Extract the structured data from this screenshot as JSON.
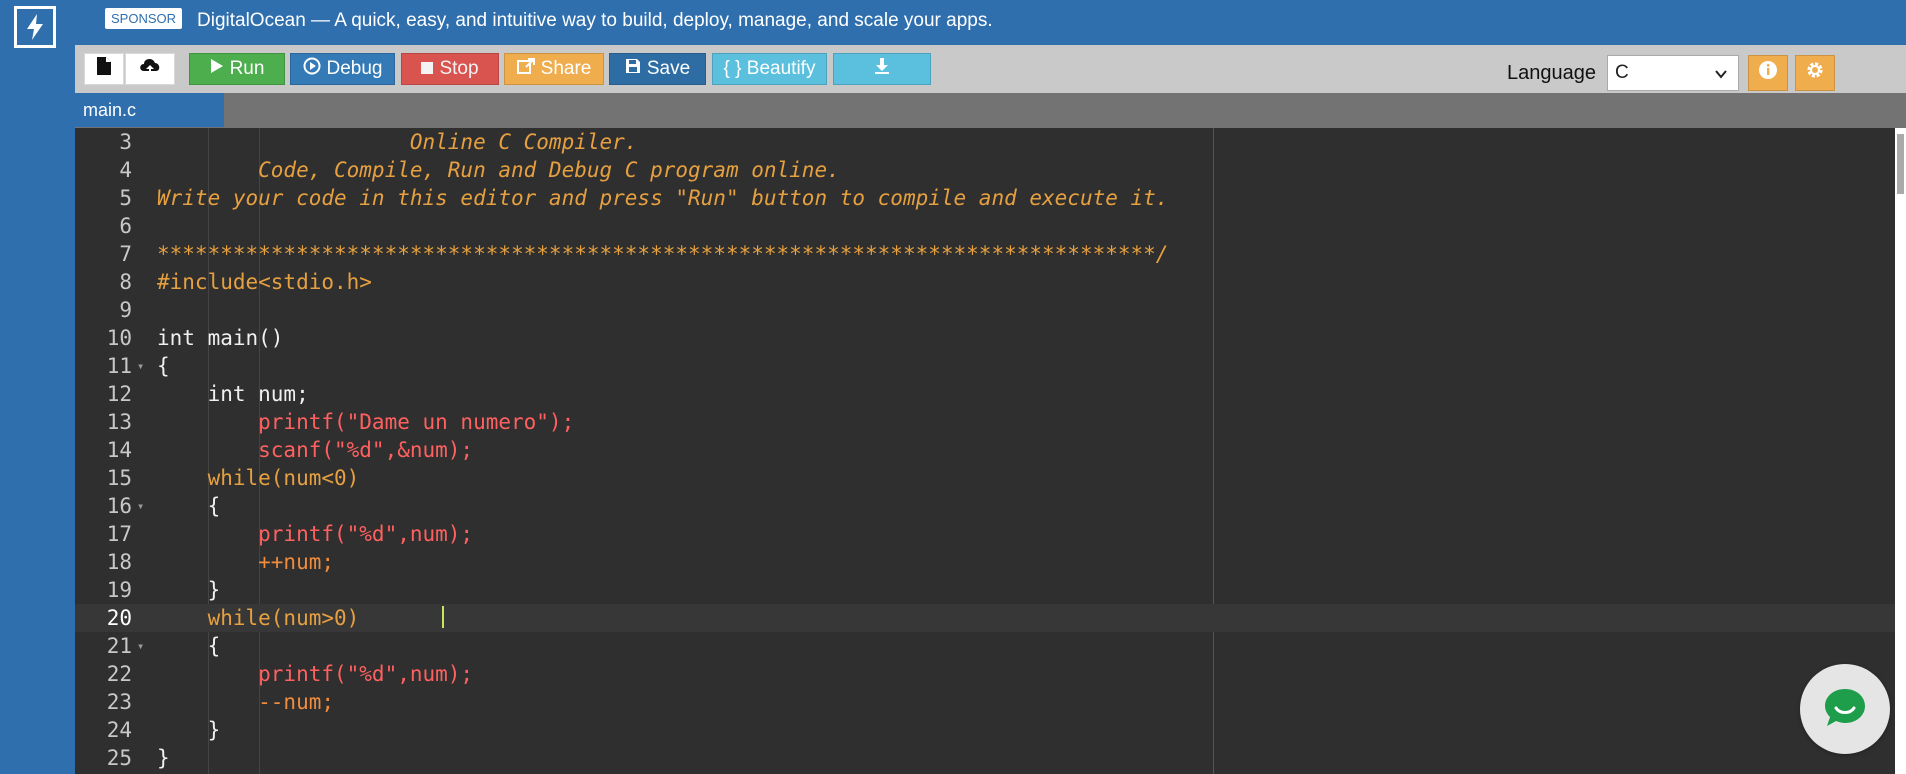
{
  "banner": {
    "sponsor_label": "SPONSOR",
    "text": "DigitalOcean — A quick, easy, and intuitive way to build, deploy, manage, and scale your apps."
  },
  "toolbar": {
    "run_label": "Run",
    "debug_label": "Debug",
    "stop_label": "Stop",
    "share_label": "Share",
    "save_label": "Save",
    "beautify_label": "{ } Beautify",
    "language_label": "Language",
    "language_value": "C"
  },
  "colors": {
    "run": "#4cae4c",
    "debug": "#337ab7",
    "stop": "#d9534f",
    "share": "#f0ad4e",
    "save": "#2e6da4",
    "beautify": "#5bc0de",
    "download": "#5bc0de",
    "info": "#f0ad4e",
    "settings": "#f0ad4e"
  },
  "tabs": [
    {
      "label": "main.c"
    }
  ],
  "editor": {
    "lines": [
      {
        "n": "3",
        "text": "                    Online C Compiler."
      },
      {
        "n": "4",
        "text": "        Code, Compile, Run and Debug C program online."
      },
      {
        "n": "5",
        "text": "Write your code in this editor and press \"Run\" button to compile and execute it."
      },
      {
        "n": "6",
        "text": ""
      },
      {
        "n": "7",
        "text": "*******************************************************************************/"
      },
      {
        "n": "8",
        "text": "#include<stdio.h>"
      },
      {
        "n": "9",
        "text": ""
      },
      {
        "n": "10",
        "text": "int main()"
      },
      {
        "n": "11",
        "text": "{"
      },
      {
        "n": "12",
        "text": "    int num;"
      },
      {
        "n": "13",
        "text": "        printf(\"Dame un numero\");"
      },
      {
        "n": "14",
        "text": "        scanf(\"%d\",&num);"
      },
      {
        "n": "15",
        "text": "    while(num<0)"
      },
      {
        "n": "16",
        "text": "    {"
      },
      {
        "n": "17",
        "text": "        printf(\"%d\",num);"
      },
      {
        "n": "18",
        "text": "        ++num;"
      },
      {
        "n": "19",
        "text": "    }"
      },
      {
        "n": "20",
        "text": "    while(num>0)"
      },
      {
        "n": "21",
        "text": "    {"
      },
      {
        "n": "22",
        "text": "        printf(\"%d\",num);"
      },
      {
        "n": "23",
        "text": "        --num;"
      },
      {
        "n": "24",
        "text": "    }"
      },
      {
        "n": "25",
        "text": "}"
      }
    ]
  }
}
